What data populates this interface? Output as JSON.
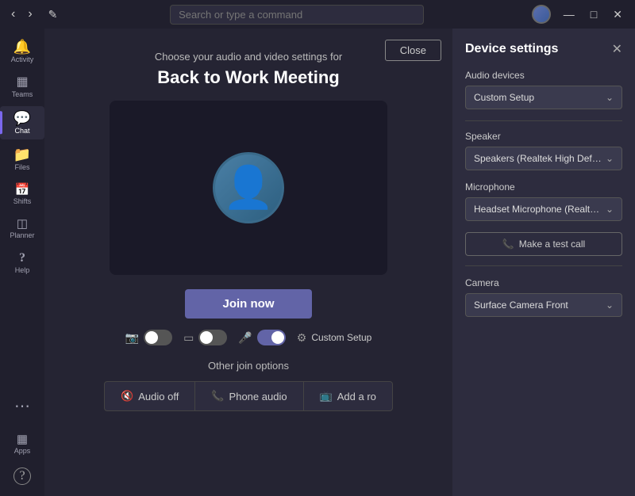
{
  "titlebar": {
    "search_placeholder": "Search or type a command",
    "nav_back": "‹",
    "nav_forward": "›",
    "edit_icon": "✏",
    "minimize": "—",
    "maximize": "□",
    "close": "✕"
  },
  "sidebar": {
    "items": [
      {
        "id": "activity",
        "label": "Activity",
        "icon": "🔔"
      },
      {
        "id": "teams",
        "label": "Teams",
        "icon": "⊞"
      },
      {
        "id": "chat",
        "label": "Chat",
        "icon": "💬",
        "active": true
      },
      {
        "id": "files",
        "label": "Files",
        "icon": "📁"
      },
      {
        "id": "shifts",
        "label": "Shifts",
        "icon": "📅"
      },
      {
        "id": "planner",
        "label": "Planner",
        "icon": "📊"
      },
      {
        "id": "help",
        "label": "Help",
        "icon": "?"
      }
    ],
    "more": "...",
    "apps_icon": "⊞",
    "apps_label": "Apps",
    "help_circle": "?"
  },
  "meeting": {
    "close_label": "Close",
    "subtitle": "Choose your audio and video settings for",
    "title": "Back to Work Meeting",
    "join_label": "Join now",
    "controls": {
      "video_off_icon": "📷",
      "blur_icon": "⬛",
      "mic_icon": "🎤",
      "settings_icon": "⚙",
      "custom_setup_label": "Custom Setup"
    },
    "other_join_title": "Other join options",
    "join_options": [
      {
        "icon": "🔇",
        "label": "Audio off"
      },
      {
        "icon": "📞",
        "label": "Phone audio"
      },
      {
        "icon": "📺",
        "label": "Add a ro"
      }
    ]
  },
  "device_settings": {
    "title": "Device settings",
    "close_icon": "✕",
    "audio_devices_label": "Audio devices",
    "audio_devices_value": "Custom Setup",
    "speaker_label": "Speaker",
    "speaker_value": "Speakers (Realtek High Definition Au...",
    "microphone_label": "Microphone",
    "microphone_value": "Headset Microphone (Realtek High D...",
    "make_test_call_icon": "📞",
    "make_test_call_label": "Make a test call",
    "camera_label": "Camera",
    "camera_value": "Surface Camera Front"
  }
}
